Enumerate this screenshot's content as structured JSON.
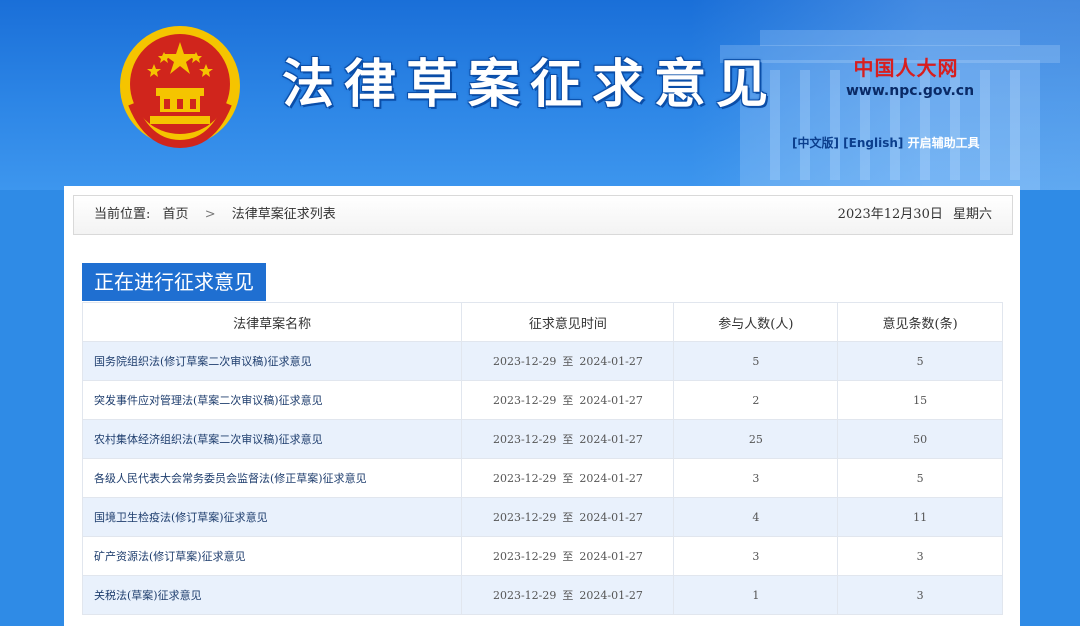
{
  "header": {
    "title": "法律草案征求意见",
    "npc_logo_text": "中国人大网",
    "npc_url": "www.npc.gov.cn",
    "lang_links": [
      "[中文版]",
      "[English]",
      "开启辅助工具"
    ]
  },
  "breadcrumb": {
    "label": "当前位置:",
    "items": [
      "首页",
      "法律草案征求列表"
    ],
    "separator": ">"
  },
  "date_info": {
    "date": "2023年12月30日",
    "weekday": "星期六"
  },
  "section_title": "正在进行征求意见",
  "table": {
    "headers": [
      "法律草案名称",
      "征求意见时间",
      "参与人数(人)",
      "意见条数(条)"
    ],
    "rows": [
      {
        "name": "国务院组织法(修订草案二次审议稿)征求意见",
        "start": "2023-12-29",
        "to": "至",
        "end": "2024-01-27",
        "participants": "5",
        "comments": "5"
      },
      {
        "name": "突发事件应对管理法(草案二次审议稿)征求意见",
        "start": "2023-12-29",
        "to": "至",
        "end": "2024-01-27",
        "participants": "2",
        "comments": "15"
      },
      {
        "name": "农村集体经济组织法(草案二次审议稿)征求意见",
        "start": "2023-12-29",
        "to": "至",
        "end": "2024-01-27",
        "participants": "25",
        "comments": "50"
      },
      {
        "name": "各级人民代表大会常务委员会监督法(修正草案)征求意见",
        "start": "2023-12-29",
        "to": "至",
        "end": "2024-01-27",
        "participants": "3",
        "comments": "5"
      },
      {
        "name": "国境卫生检疫法(修订草案)征求意见",
        "start": "2023-12-29",
        "to": "至",
        "end": "2024-01-27",
        "participants": "4",
        "comments": "11"
      },
      {
        "name": "矿产资源法(修订草案)征求意见",
        "start": "2023-12-29",
        "to": "至",
        "end": "2024-01-27",
        "participants": "3",
        "comments": "3"
      },
      {
        "name": "关税法(草案)征求意见",
        "start": "2023-12-29",
        "to": "至",
        "end": "2024-01-27",
        "participants": "1",
        "comments": "3"
      }
    ]
  },
  "colors": {
    "banner_blue": "#2d86e6",
    "title_bar_blue": "#1f6fd1",
    "row_alt": "#e9f1fc",
    "emblem_red": "#d0251c",
    "emblem_gold": "#f5c400",
    "logo_red": "#d81e1e"
  },
  "icons": [
    "national-emblem-icon",
    "building-silhouette-icon"
  ]
}
